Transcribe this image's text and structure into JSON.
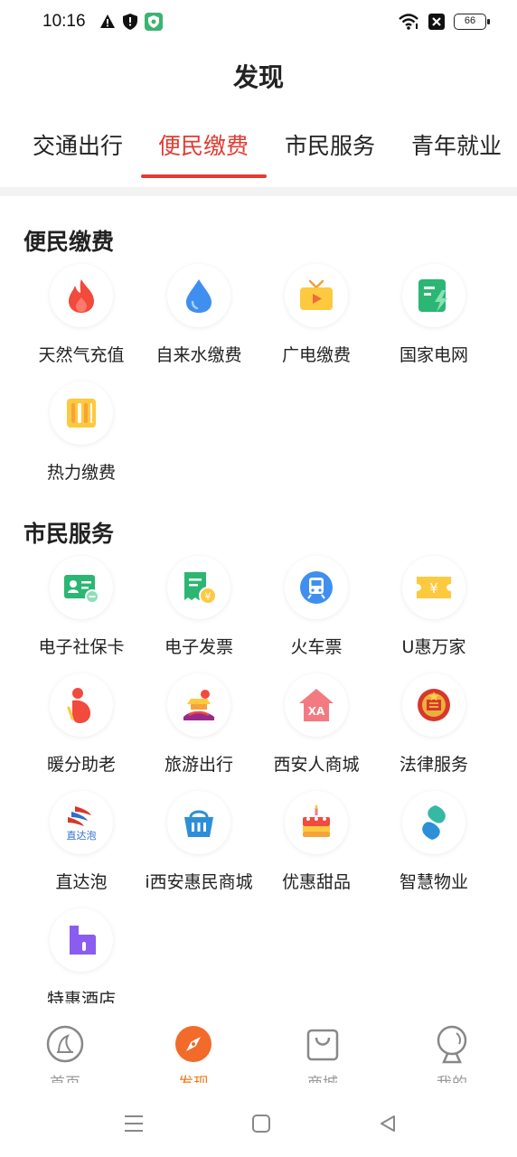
{
  "status_bar": {
    "time": "10:16",
    "battery": "66",
    "left_icons": [
      "warning-icon",
      "shield-icon",
      "security-app-icon"
    ],
    "right_icons": [
      "wifi-icon",
      "sim-x-icon",
      "battery-icon"
    ]
  },
  "page_title": "发现",
  "tabs": [
    {
      "label": "交通出行",
      "active": false
    },
    {
      "label": "便民缴费",
      "active": true
    },
    {
      "label": "市民服务",
      "active": false
    },
    {
      "label": "青年就业",
      "active": false
    }
  ],
  "accent_color": "#e23b32",
  "sections": [
    {
      "title": "便民缴费",
      "items": [
        {
          "label": "天然气充值",
          "icon": "flame-icon"
        },
        {
          "label": "自来水缴费",
          "icon": "water-drop-icon"
        },
        {
          "label": "广电缴费",
          "icon": "tv-icon"
        },
        {
          "label": "国家电网",
          "icon": "power-grid-icon"
        },
        {
          "label": "热力缴费",
          "icon": "radiator-icon"
        }
      ]
    },
    {
      "title": "市民服务",
      "items": [
        {
          "label": "电子社保卡",
          "icon": "social-security-card-icon"
        },
        {
          "label": "电子发票",
          "icon": "invoice-icon"
        },
        {
          "label": "火车票",
          "icon": "train-icon"
        },
        {
          "label": "U惠万家",
          "icon": "coupon-icon"
        },
        {
          "label": "暖分助老",
          "icon": "elderly-care-icon"
        },
        {
          "label": "旅游出行",
          "icon": "travel-icon"
        },
        {
          "label": "西安人商城",
          "icon": "xa-mall-icon"
        },
        {
          "label": "法律服务",
          "icon": "emblem-icon"
        },
        {
          "label": "直达泡",
          "icon": "zhidapao-logo-icon",
          "logo_text": "直达泡"
        },
        {
          "label": "i西安惠民商城",
          "icon": "shopping-basket-icon"
        },
        {
          "label": "优惠甜品",
          "icon": "cake-icon"
        },
        {
          "label": "智慧物业",
          "icon": "smart-property-icon"
        },
        {
          "label": "特惠酒店",
          "icon": "hotel-icon"
        }
      ]
    }
  ],
  "bottom_nav": [
    {
      "label": "首页",
      "icon": "home-icon",
      "active": false
    },
    {
      "label": "发现",
      "icon": "compass-icon",
      "active": true
    },
    {
      "label": "商城",
      "icon": "shopping-bag-icon",
      "active": false
    },
    {
      "label": "我的",
      "icon": "profile-icon",
      "active": false
    }
  ]
}
